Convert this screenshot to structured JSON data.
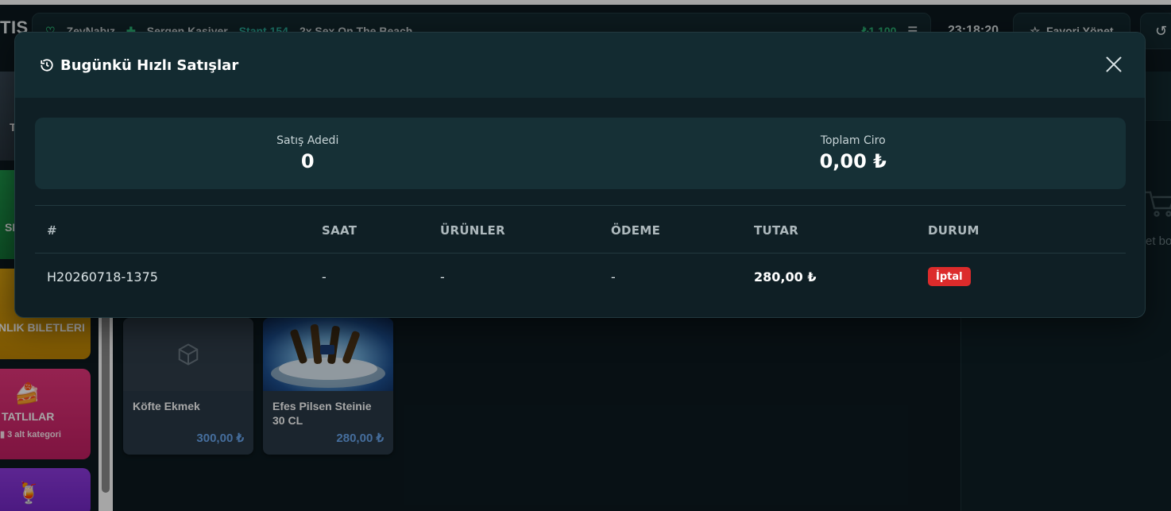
{
  "app": {
    "title_fragment": "TIŞ"
  },
  "topbar": {
    "item1": "ZevNabız",
    "item2": "Sergen Kasiyer",
    "item3": "Stant 154",
    "item4": "2x Sex On The Beach",
    "total": "₺1.100"
  },
  "clock": "23:18:20",
  "top_button": {
    "label": "Favori Yönet"
  },
  "categories": [
    {
      "label": "T"
    },
    {
      "label": "SI"
    },
    {
      "label": "NLIK BILETLERI"
    },
    {
      "label": "TATLILAR",
      "sub": "3 alt kategori"
    },
    {
      "label": ""
    }
  ],
  "products": [
    {
      "name": "Köfte Ekmek",
      "price": "300,00 ₺"
    },
    {
      "name": "Efes Pilsen Steinie 30 CL",
      "price": "280,00 ₺"
    }
  ],
  "cart": {
    "empty_text": "et bo"
  },
  "modal": {
    "title": "Bugünkü Hızlı Satışlar",
    "stats": {
      "count_label": "Satış Adedi",
      "count_value": "0",
      "revenue_label": "Toplam Ciro",
      "revenue_value": "0,00 ₺"
    },
    "table": {
      "headers": [
        "#",
        "SAAT",
        "ÜRÜNLER",
        "ÖDEME",
        "TUTAR",
        "DURUM"
      ],
      "rows": [
        {
          "id": "H20260718-1375",
          "time": "-",
          "products": "-",
          "payment": "-",
          "amount": "280,00 ₺",
          "status": "İptal"
        }
      ]
    }
  },
  "colors": {
    "accent_green": "#2ec27e",
    "cancel_red": "#dc2b2b",
    "price_blue": "#6aa8f0"
  }
}
